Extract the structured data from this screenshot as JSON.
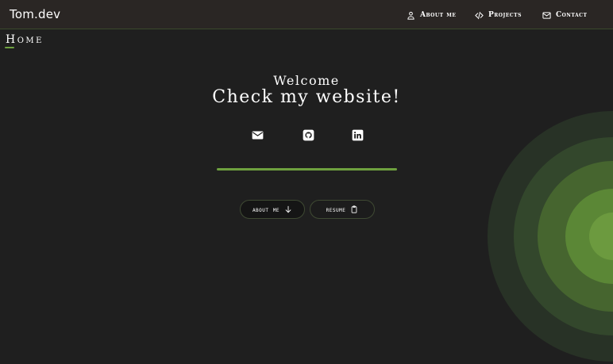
{
  "brand": "Tom.dev",
  "nav": {
    "about": {
      "label": "About me",
      "icon": "user-icon"
    },
    "projects": {
      "label": "Projects",
      "icon": "code-icon"
    },
    "contact": {
      "label": "Contact",
      "icon": "envelope-icon"
    }
  },
  "section": {
    "label": "Home"
  },
  "hero": {
    "welcome": "Welcome",
    "headline": "Check my website!"
  },
  "social": [
    {
      "icon": "envelope-icon"
    },
    {
      "icon": "github-icon"
    },
    {
      "icon": "linkedin-icon"
    }
  ],
  "buttons": {
    "about": {
      "label": "about me",
      "icon": "arrow-down-icon"
    },
    "resume": {
      "label": "resume",
      "icon": "clipboard-icon"
    }
  },
  "colors": {
    "accent": "#6ea13f",
    "background": "#1f1f1f",
    "navbar": "#2a2624"
  }
}
